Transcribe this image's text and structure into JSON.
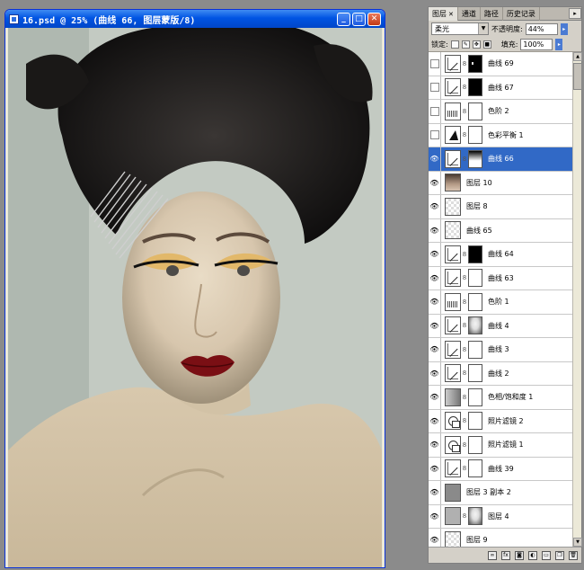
{
  "document": {
    "title": "16.psd @ 25% (曲线 66, 图层蒙版/8)",
    "controls": [
      "_",
      "□",
      "✕"
    ]
  },
  "panel": {
    "tabs": [
      {
        "label": "图层",
        "active": true
      },
      {
        "label": "通道",
        "active": false
      },
      {
        "label": "路径",
        "active": false
      },
      {
        "label": "历史记录",
        "active": false
      }
    ],
    "blend_mode": "柔光",
    "opacity_label": "不透明度:",
    "opacity_value": "44%",
    "lock_label": "锁定:",
    "fill_label": "填充:",
    "fill_value": "100%",
    "layers": [
      {
        "name": "曲线 69",
        "visible": false,
        "selected": false,
        "thumb": "curve",
        "mask": "dots"
      },
      {
        "name": "曲线 67",
        "visible": false,
        "selected": false,
        "thumb": "curve",
        "mask": "black"
      },
      {
        "name": "色阶 2",
        "visible": false,
        "selected": false,
        "thumb": "levels",
        "mask": "white"
      },
      {
        "name": "色彩平衡 1",
        "visible": false,
        "selected": false,
        "thumb": "balance",
        "mask": "white"
      },
      {
        "name": "曲线 66",
        "visible": true,
        "selected": true,
        "thumb": "curve",
        "mask": "fade"
      },
      {
        "name": "图层 10",
        "visible": true,
        "selected": false,
        "thumb": "photo",
        "mask": ""
      },
      {
        "name": "图层 8",
        "visible": true,
        "selected": false,
        "thumb": "checker",
        "mask": ""
      },
      {
        "name": "曲线 65",
        "visible": true,
        "selected": false,
        "thumb": "checker",
        "mask": ""
      },
      {
        "name": "曲线 64",
        "visible": true,
        "selected": false,
        "thumb": "curve",
        "mask": "black"
      },
      {
        "name": "曲线 63",
        "visible": true,
        "selected": false,
        "thumb": "curve",
        "mask": "white"
      },
      {
        "name": "色阶 1",
        "visible": true,
        "selected": false,
        "thumb": "levels",
        "mask": "white"
      },
      {
        "name": "曲线 4",
        "visible": true,
        "selected": false,
        "thumb": "curve",
        "mask": "face"
      },
      {
        "name": "曲线 3",
        "visible": true,
        "selected": false,
        "thumb": "curve",
        "mask": "white"
      },
      {
        "name": "曲线 2",
        "visible": true,
        "selected": false,
        "thumb": "curve",
        "mask": "white"
      },
      {
        "name": "色相/饱和度 1",
        "visible": true,
        "selected": false,
        "thumb": "hue",
        "mask": "white"
      },
      {
        "name": "照片滤镜 2",
        "visible": true,
        "selected": false,
        "thumb": "filter",
        "mask": "white"
      },
      {
        "name": "照片滤镜 1",
        "visible": true,
        "selected": false,
        "thumb": "filter",
        "mask": "white"
      },
      {
        "name": "曲线 39",
        "visible": true,
        "selected": false,
        "thumb": "curve",
        "mask": "white"
      },
      {
        "name": "图层 3 副本 2",
        "visible": true,
        "selected": false,
        "thumb": "gray",
        "mask": ""
      },
      {
        "name": "图层 4",
        "visible": true,
        "selected": false,
        "thumb": "graylight",
        "mask": "face"
      },
      {
        "name": "图层 9",
        "visible": true,
        "selected": false,
        "thumb": "checker",
        "mask": ""
      }
    ],
    "footer_icons": [
      "link-icon",
      "fx-icon",
      "add-mask-icon",
      "adjustment-icon",
      "group-icon",
      "new-layer-icon",
      "trash-icon"
    ]
  },
  "colors": {
    "selection": "#3169c6",
    "titlebar": "#0054e3",
    "lips": "#7a0f14"
  }
}
